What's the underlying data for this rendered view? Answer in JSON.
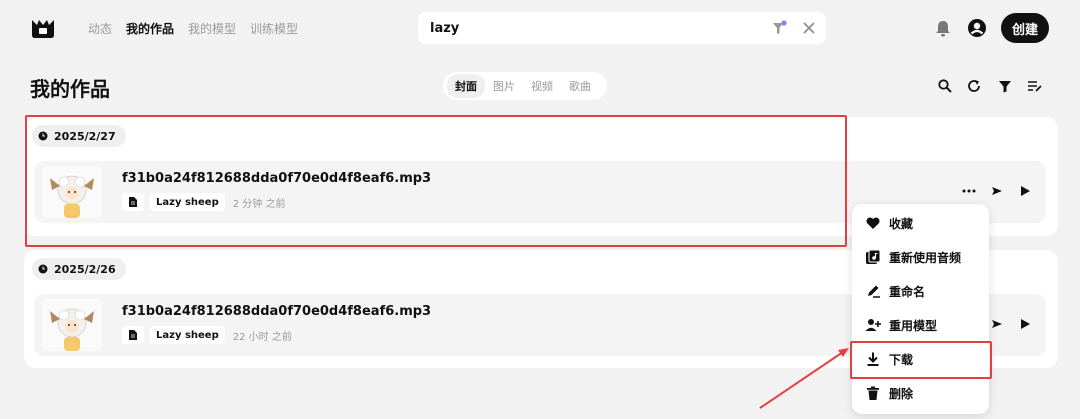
{
  "nav": {
    "items": [
      "动态",
      "我的作品",
      "我的模型",
      "训练模型"
    ],
    "active_index": 1
  },
  "search": {
    "value": "lazy"
  },
  "create_label": "创建",
  "page_title": "我的作品",
  "segments": {
    "items": [
      "封面",
      "图片",
      "视频",
      "歌曲"
    ],
    "active_index": 0
  },
  "groups": [
    {
      "date": "2025/2/27",
      "item": {
        "filename": "f31b0a24f812688dda0f70e0d4f8eaf6.mp3",
        "model": "Lazy sheep",
        "time_ago": "2 分钟 之前"
      }
    },
    {
      "date": "2025/2/26",
      "item": {
        "filename": "f31b0a24f812688dda0f70e0d4f8eaf6.mp3",
        "model": "Lazy sheep",
        "time_ago": "22 小时 之前"
      }
    }
  ],
  "context_menu": {
    "items": [
      {
        "label": "收藏",
        "icon": "heart-icon"
      },
      {
        "label": "重新使用音频",
        "icon": "reuse-audio-icon"
      },
      {
        "label": "重命名",
        "icon": "rename-pen-icon"
      },
      {
        "label": "重用模型",
        "icon": "add-person-icon"
      },
      {
        "label": "下载",
        "icon": "download-icon"
      },
      {
        "label": "删除",
        "icon": "trash-icon"
      }
    ]
  },
  "colors": {
    "accent_dark": "#111111",
    "highlight_red": "#e34040",
    "notify_dot": "#8b7cf6"
  }
}
